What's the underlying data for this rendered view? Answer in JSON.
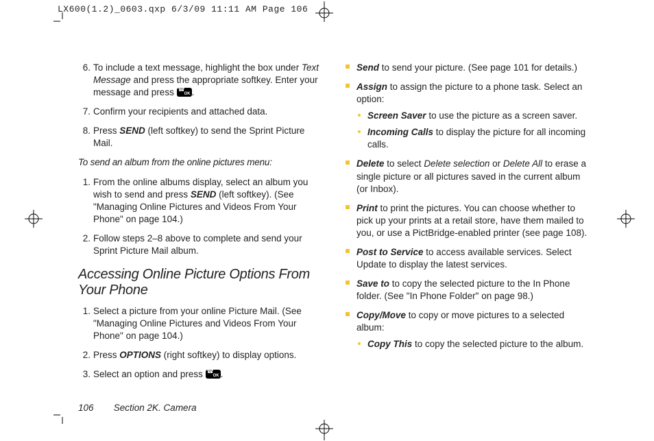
{
  "slug": "LX600(1.2)_0603.qxp  6/3/09  11:11 AM  Page 106",
  "footer": {
    "page": "106",
    "section": "Section 2K. Camera"
  },
  "left": {
    "items68": [
      {
        "n": "6.",
        "pre": "To include a text message, highlight the box under ",
        "em": "Text Message",
        "mid": " and press the appropriate softkey. Enter your message and press ",
        "key": true,
        "post": "."
      },
      {
        "n": "7.",
        "text": "Confirm your recipients and attached data."
      },
      {
        "n": "8.",
        "pre": "Press ",
        "bi": "SEND",
        "post": " (left softkey) to send the Sprint Picture Mail."
      }
    ],
    "intro": "To send an album from the online pictures menu:",
    "items12": [
      {
        "n": "1.",
        "pre": "From the online albums display, select an album you wish to send and press ",
        "bi": "SEND",
        "post": " (left softkey). (See \"Managing Online Pictures and Videos From Your Phone\" on page 104.)"
      },
      {
        "n": "2.",
        "text": "Follow steps 2–8 above to complete and send your Sprint Picture Mail album."
      }
    ],
    "subhead": "Accessing Online Picture Options From Your Phone",
    "items13": [
      {
        "n": "1.",
        "text": "Select a picture from your online Picture Mail. (See \"Managing Online Pictures and Videos From Your Phone\" on page 104.)"
      },
      {
        "n": "2.",
        "pre": "Press ",
        "bi": "OPTIONS",
        "post": " (right softkey) to display options."
      },
      {
        "n": "3.",
        "pre": "Select an option and press ",
        "key": true,
        "post": "."
      }
    ]
  },
  "right": {
    "opts": [
      {
        "bi": "Send",
        "text": "  to send your picture. (See page 101 for details.)"
      },
      {
        "bi": "Assign",
        "text": "  to assign the picture to a phone task. Select an option:",
        "sub": [
          {
            "bi": "Screen Saver",
            "text": "  to use the picture as a screen saver."
          },
          {
            "bi": " Incoming Calls",
            "text": "  to display the picture for all incoming calls."
          }
        ]
      },
      {
        "bi": "Delete",
        "text_parts": [
          {
            "t": " to select "
          },
          {
            "i": "Delete selection"
          },
          {
            "t": " or "
          },
          {
            "i": "Delete All"
          },
          {
            "t": " to erase a single picture or all pictures saved in the current album (or Inbox)."
          }
        ]
      },
      {
        "bi": "Print",
        "text": "  to print the pictures. You can choose whether to pick up your prints at a retail store, have them mailed to you, or use a PictBridge-enabled printer (see page 108)."
      },
      {
        "bi": "Post to Service",
        "text": " to access available services. Select Update to display the latest services."
      },
      {
        "bi": "Save to",
        "text": " to copy the selected picture to the In Phone folder. (See \"In Phone Folder\" on page 98.)"
      },
      {
        "bi": "Copy/Move",
        "text": " to copy or move pictures to a selected album:",
        "sub": [
          {
            "bi": "Copy This",
            "text": " to copy the selected picture to the album."
          }
        ]
      }
    ]
  }
}
